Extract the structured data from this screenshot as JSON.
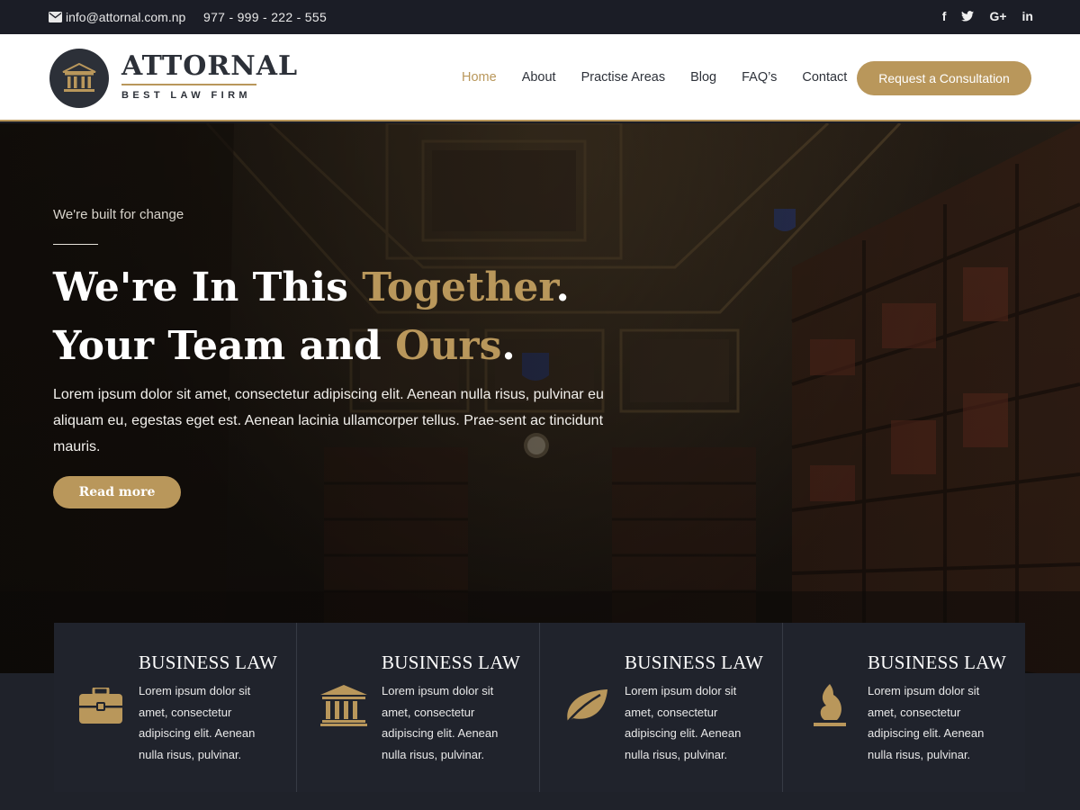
{
  "topbar": {
    "email": "info@attornal.com.np",
    "phone": "977 - 999 - 222 - 555",
    "social": [
      {
        "icon": "facebook-icon",
        "glyph": "f"
      },
      {
        "icon": "twitter-icon",
        "glyph": "🐦"
      },
      {
        "icon": "google-plus-icon",
        "glyph": "G+"
      },
      {
        "icon": "linkedin-icon",
        "glyph": "in"
      }
    ]
  },
  "header": {
    "logo_title": "ATTORNAL",
    "logo_subtitle": "BEST LAW FIRM",
    "nav": [
      "Home",
      "About",
      "Practise Areas",
      "Blog",
      "FAQ’s",
      "Contact"
    ],
    "active_nav": "Home",
    "cta": "Request a Consultation"
  },
  "hero": {
    "tagline": "We're built for change",
    "headline": {
      "part1": "We're In This ",
      "gold1": "Together",
      "part2": ". Your Team and ",
      "gold2": "Ours",
      "part3": "."
    },
    "lead": "Lorem ipsum dolor sit amet, consectetur adipiscing elit. Aenean nulla risus, pulvinar eu aliquam eu, egestas eget est. Aenean lacinia ullamcorper tellus. Prae-sent ac tincidunt mauris.",
    "button": "Read more"
  },
  "features": [
    {
      "icon": "briefcase-icon",
      "title": "BUSINESS LAW",
      "text": "Lorem ipsum dolor sit amet, consectetur adipiscing elit. Aenean nulla risus, pulvinar."
    },
    {
      "icon": "courthouse-icon",
      "title": "BUSINESS LAW",
      "text": "Lorem ipsum dolor sit amet, consectetur adipiscing elit. Aenean nulla risus, pulvinar."
    },
    {
      "icon": "leaf-icon",
      "title": "BUSINESS LAW",
      "text": "Lorem ipsum dolor sit amet, consectetur adipiscing elit. Aenean nulla risus, pulvinar."
    },
    {
      "icon": "flame-icon",
      "title": "BUSINESS LAW",
      "text": "Lorem ipsum dolor sit amet, consectetur adipiscing elit. Aenean nulla risus, pulvinar."
    }
  ],
  "colors": {
    "accent": "#b9975b",
    "dark": "#1b1d26",
    "header_bg": "#ffffff"
  }
}
